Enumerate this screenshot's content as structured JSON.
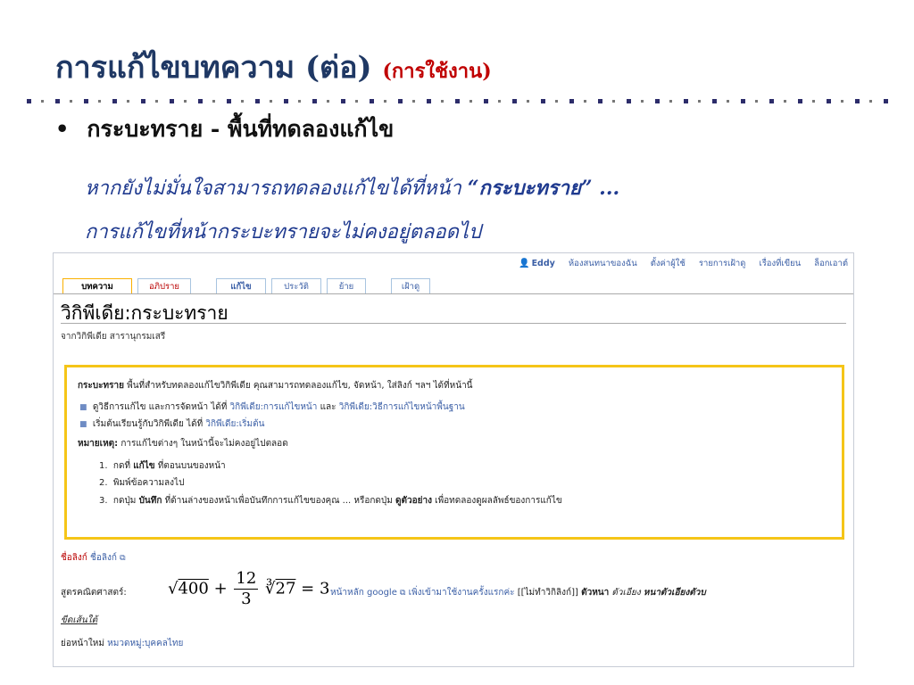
{
  "slide": {
    "title": "การแก้ไขบทความ (ต่อ)",
    "subtitle": "(การใช้งาน)",
    "bullet_glyph": "•",
    "bullet_text": "กระบะทราย - พื้นที่ทดลองแก้ไข",
    "line1_prefix": "หากยังไม่มั่นใจสามารถทดลองแก้ไขได้ที่หน้า ",
    "line1_quote": "“กระบะทราย”",
    "line1_suffix": " ...",
    "line2": "การแก้ไขที่หน้ากระบะทรายจะไม่คงอยู่ตลอดไป"
  },
  "wiki": {
    "personal": {
      "user_icon": "👤",
      "user": "Eddy",
      "talk": "ห้องสนทนาของฉัน",
      "prefs": "ตั้งค่าผู้ใช้",
      "watchlist": "รายการเฝ้าดู",
      "contribs": "เรื่องที่เขียน",
      "logout": "ล็อกเอาต์"
    },
    "tabs": {
      "article": "บทความ",
      "discussion": "อภิปราย",
      "edit": "แก้ไข",
      "history": "ประวัติ",
      "move": "ย้าย",
      "watch": "เฝ้าดู"
    },
    "page_title": "วิกิพีเดีย:กระบะทราย",
    "site_sub": "จากวิกิพีเดีย สารานุกรมเสรี",
    "notice": {
      "intro_bold": "กระบะทราย",
      "intro_rest": " พื้นที่สำหรับทดลองแก้ไขวิกิพีเดีย คุณสามารถทดลองแก้ไข, จัดหน้า, ใส่ลิงก์ ฯลฯ ได้ที่หน้านี้",
      "bullet_glyph": "■",
      "b1_text": "ดูวิธีการแก้ไข และการจัดหน้า ได้ที่ ",
      "b1_link1": "วิกิพีเดีย:การแก้ไขหน้า",
      "b1_and": " และ ",
      "b1_link2": "วิกิพีเดีย:วิธีการแก้ไขหน้าพื้นฐาน",
      "b2_text": "เริ่มต้นเรียนรู้กับวิกิพีเดีย ได้ที่ ",
      "b2_link": "วิกิพีเดีย:เริ่มต้น",
      "note_bold": "หมายเหตุ:",
      "note_rest": " การแก้ไขต่างๆ ในหน้านี้จะไม่คงอยู่ไปตลอด",
      "steps": [
        {
          "num": "1.",
          "pre": "กดที่ ",
          "bold": "แก้ไข",
          "post": " ที่ตอนบนของหน้า"
        },
        {
          "num": "2.",
          "pre": "พิมพ์ข้อความลงไป",
          "bold": "",
          "post": ""
        },
        {
          "num": "3.",
          "pre": "กดปุ่ม ",
          "bold": "บันทึก",
          "post": " ที่ด้านล่างของหน้าเพื่อบันทึกการแก้ไขของคุณ ... หรือกดปุ่ม ",
          "bold2": "ดูตัวอย่าง",
          "post2": " เพื่อทดลองดูผลลัพธ์ของการแก้ไข"
        }
      ]
    },
    "below": {
      "link_a": "ชื่อลิงก์",
      "link_b": "ชื่อลิงก์",
      "ext_icon": "⧉",
      "math_label": "สูตรคณิตศาสตร์:",
      "math_sqrt": "√",
      "math_sqrt_arg": "400",
      "math_plus": "+",
      "math_num": "12",
      "math_den": "3",
      "math_cuberoot": "∛",
      "math_cube_arg": "27",
      "math_eq": "= 3",
      "google_link": "หน้าหลัก google",
      "newbie": "เพิ่งเข้ามาใช้งานครั้งแรกค่ะ",
      "wiki_markup": "[[ไม่ทำวิกิลิงก์]]",
      "bold_text": "ตัวหนา",
      "italic_text": "ตัวเอียง",
      "bold_italic": "หนาตัวเอียงตัวบ",
      "underlined": "ขีดเส้นใต้",
      "subpage": "ย่อหน้าใหม่ ",
      "category": "หมวดหมู่:บุคคลไทย"
    }
  }
}
